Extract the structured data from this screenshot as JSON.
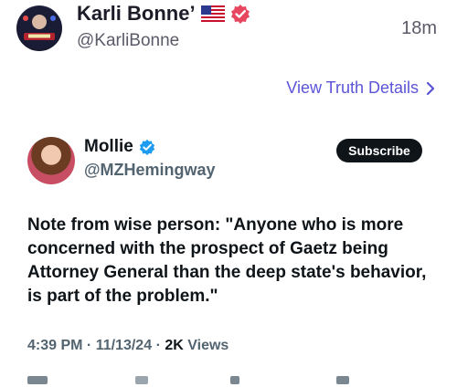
{
  "post": {
    "author_name": "Karli Bonne’",
    "handle": "@KarliBonne",
    "timestamp": "18m",
    "view_details_label": "View Truth Details",
    "avatar_text": "",
    "flag_icon": "us-flag-icon",
    "verified_icon": "verified-badge-icon",
    "verified_color": "#e7475e"
  },
  "embed": {
    "author_name": "Mollie",
    "handle": "@MZHemingway",
    "verified_color": "#1d9bf0",
    "subscribe_label": "Subscribe",
    "text": "Note from wise person: \"Anyone who is more concerned with the prospect of Gaetz being Attorney General than the deep state's behavior, is part of the problem.\"",
    "time": "4:39 PM",
    "date": "11/13/24",
    "separator": "·",
    "views_count": "2K",
    "views_label": "Views"
  },
  "colors": {
    "link": "#5b54d6",
    "text": "#0f1419",
    "muted": "#536471"
  }
}
